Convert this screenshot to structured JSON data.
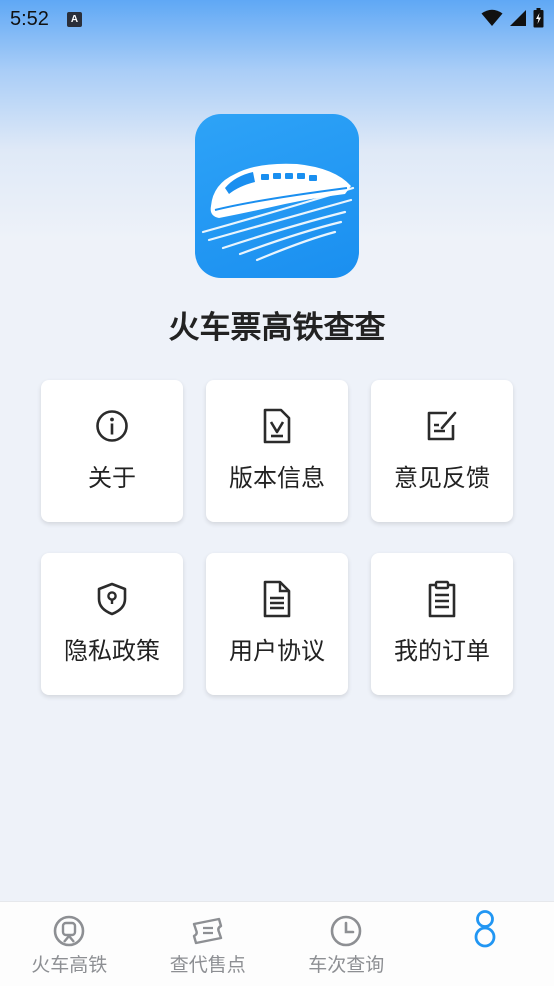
{
  "status_bar": {
    "time": "5:52",
    "notification_badge": "A"
  },
  "app": {
    "title": "火车票高铁查查"
  },
  "menu": [
    {
      "label": "关于",
      "icon": "info-icon"
    },
    {
      "label": "版本信息",
      "icon": "version-document-icon"
    },
    {
      "label": "意见反馈",
      "icon": "feedback-edit-icon"
    },
    {
      "label": "隐私政策",
      "icon": "privacy-shield-icon"
    },
    {
      "label": "用户协议",
      "icon": "agreement-document-icon"
    },
    {
      "label": "我的订单",
      "icon": "order-clipboard-icon"
    }
  ],
  "tabs": [
    {
      "label": "火车高铁",
      "icon": "train-icon",
      "active": false
    },
    {
      "label": "查代售点",
      "icon": "ticket-icon",
      "active": false
    },
    {
      "label": "车次查询",
      "icon": "clock-icon",
      "active": false
    },
    {
      "label": "",
      "icon": "profile-icon",
      "active": true
    }
  ],
  "colors": {
    "accent": "#2196f3",
    "tab_inactive": "#8d8f93",
    "logo_bg": "#1a8ff0",
    "page_bg": "#eef2f9"
  }
}
